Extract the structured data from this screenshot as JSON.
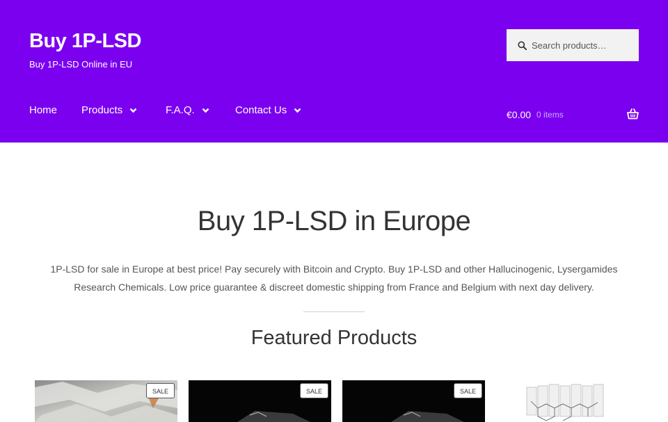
{
  "site": {
    "title": "Buy 1P-LSD",
    "tagline": "Buy 1P-LSD Online in EU",
    "header_bg": "#7b00f0"
  },
  "search": {
    "placeholder": "Search products…",
    "icon": "search-icon"
  },
  "nav": {
    "items": [
      {
        "label": "Home",
        "has_dropdown": false
      },
      {
        "label": "Products",
        "has_dropdown": true
      },
      {
        "label": "F.A.Q.",
        "has_dropdown": true
      },
      {
        "label": "Contact Us",
        "has_dropdown": true
      }
    ]
  },
  "cart": {
    "total": "€0.00",
    "count": "0 items",
    "icon": "basket-icon"
  },
  "hero": {
    "title": "Buy 1P-LSD in Europe",
    "description": "1P-LSD for sale in Europe at best price! Pay securely with Bitcoin and Crypto. Buy 1P-LSD and other Hallucinogenic, Lysergamides Research Chemicals. Low price guarantee & discreet domestic shipping from France and Belgium with next day delivery."
  },
  "featured": {
    "title": "Featured Products",
    "products": [
      {
        "badge": "SALE"
      },
      {
        "badge": "SALE"
      },
      {
        "badge": "SALE"
      },
      {
        "badge": ""
      }
    ]
  }
}
